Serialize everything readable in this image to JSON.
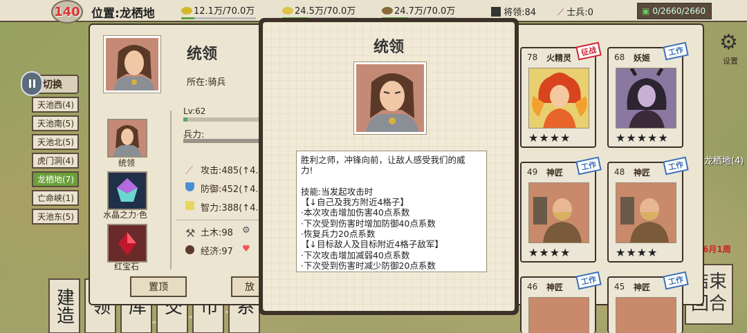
{
  "topbar": {
    "level": "140",
    "location": "位置:龙栖地",
    "resources": [
      {
        "name": "gold-icon",
        "text": "12.1万/70.0万",
        "color": "#d4b82a",
        "fill": 0.173
      },
      {
        "name": "grain-icon",
        "text": "24.5万/70.0万",
        "color": "#e0c24a",
        "fill": 0.35
      },
      {
        "name": "wood-icon",
        "text": "24.7万/70.0万",
        "color": "#8a6a3a",
        "fill": 0.353
      }
    ],
    "generals": "将领:84",
    "soldiers": "士兵:0",
    "troops": "0/2660/2660"
  },
  "left": {
    "switch_label": "切换",
    "locations": [
      {
        "label": "天池西(4)",
        "active": false
      },
      {
        "label": "天池南(5)",
        "active": false
      },
      {
        "label": "天池北(5)",
        "active": false
      },
      {
        "label": "虎门洞(4)",
        "active": false
      },
      {
        "label": "龙栖地(7)",
        "active": true
      },
      {
        "label": "亡命峡(1)",
        "active": false
      },
      {
        "label": "天池东(5)",
        "active": false
      }
    ],
    "bottom_buttons": [
      "建造",
      "领",
      "库",
      "交",
      "市",
      "系"
    ]
  },
  "right": {
    "settings_label": "设置",
    "map_loc": "龙栖地(4)",
    "date": "6月1周",
    "end_turn": "结束回合"
  },
  "general": {
    "name": "统领",
    "location": "所在:骑兵",
    "level": "Lv:62",
    "troops_label": "兵力:",
    "attack": "攻击:485(↑4.1",
    "defense": "防御:452(↑4.8",
    "wisdom": "智力:388(↑4.1",
    "earthwork": "土木:98",
    "economy": "经济:97",
    "side_items": [
      {
        "label": "统领"
      },
      {
        "label": "水晶之力·色"
      },
      {
        "label": "红宝石"
      }
    ],
    "top_button": "置顶",
    "put_button": "放"
  },
  "cards": [
    {
      "num": "78",
      "name": "火精灵",
      "tag": "征战",
      "tag_type": "war",
      "stars": "★★★★",
      "art": "fire"
    },
    {
      "num": "68",
      "name": "妖姬",
      "tag": "工作",
      "tag_type": "work",
      "stars": "★★★★★",
      "art": "demon"
    },
    {
      "num": "49",
      "name": "神匠",
      "tag": "工作",
      "tag_type": "work",
      "stars": "★★★★",
      "art": "smith"
    },
    {
      "num": "48",
      "name": "神匠",
      "tag": "工作",
      "tag_type": "work",
      "stars": "★★★★",
      "art": "smith"
    },
    {
      "num": "46",
      "name": "神匠",
      "tag": "工作",
      "tag_type": "work",
      "stars": "",
      "art": "smith"
    },
    {
      "num": "45",
      "name": "神匠",
      "tag": "工作",
      "tag_type": "work",
      "stars": "",
      "art": "smith"
    }
  ],
  "dialog": {
    "title": "统领",
    "description": [
      "胜利之师，冲锋向前，让敌人感受我们的威",
      "力!",
      "",
      "技能:当发起攻击时",
      "【↓自己及我方附近4格子】",
      "·本次攻击增加伤害40点系数",
      "·下次受到伤害时增加防御40点系数",
      "·恢复兵力20点系数",
      "【↓目标敌人及目标附近4格子敌军】",
      "·下次攻击增加减弱40点系数",
      "·下次受到伤害时减少防御20点系数"
    ]
  }
}
